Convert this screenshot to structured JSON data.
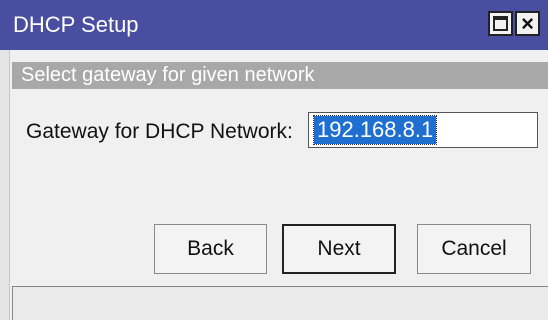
{
  "window": {
    "title": "DHCP Setup",
    "maximize_icon": "maximize-icon",
    "close_icon": "close-icon"
  },
  "hint": {
    "text": "Select gateway for given network"
  },
  "form": {
    "gateway_label": "Gateway for DHCP Network:",
    "gateway_value": "192.168.8.1"
  },
  "buttons": {
    "back": "Back",
    "next": "Next",
    "cancel": "Cancel"
  },
  "colors": {
    "titlebar": "#4a4ea0",
    "hint_bar": "#a8a8a8",
    "selection": "#1f6fd0"
  }
}
